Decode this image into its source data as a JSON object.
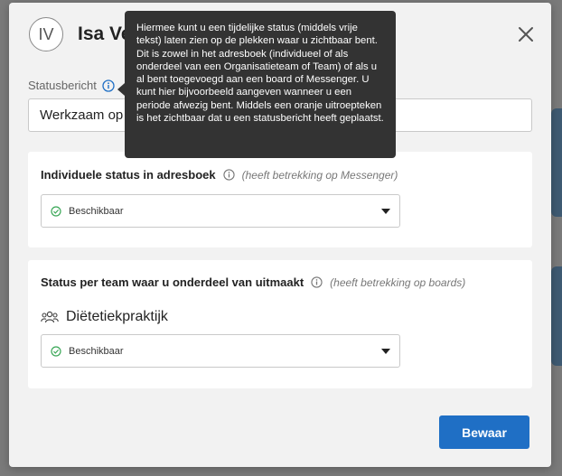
{
  "header": {
    "avatar_initials": "IV",
    "user_name": "Isa Ve"
  },
  "status_message": {
    "label": "Statusbericht",
    "value": "Werkzaam op m"
  },
  "tooltip": {
    "text": "Hiermee kunt u een tijdelijke status (middels vrije tekst) laten zien op de plekken waar u zichtbaar bent. Dit is zowel in het adresboek (individueel of als onderdeel van een Organisatieteam of Team) of als u al bent toegevoegd aan een board of Messenger. U kunt hier bijvoorbeeld aangeven wanneer u een periode afwezig bent. Middels een oranje uitroepteken is het zichtbaar dat u een statusbericht heeft geplaatst."
  },
  "individual_status": {
    "title": "Individuele status in adresboek",
    "note": "(heeft betrekking op Messenger)",
    "selected": "Beschikbaar"
  },
  "team_status": {
    "title": "Status per team waar u onderdeel van uitmaakt",
    "note": "(heeft betrekking op boards)",
    "team_name": "Diëtetiekpraktijk",
    "selected": "Beschikbaar"
  },
  "actions": {
    "save_label": "Bewaar"
  },
  "colors": {
    "primary": "#1f6fc5",
    "available": "#3aa757",
    "tooltip_bg": "#333333"
  }
}
